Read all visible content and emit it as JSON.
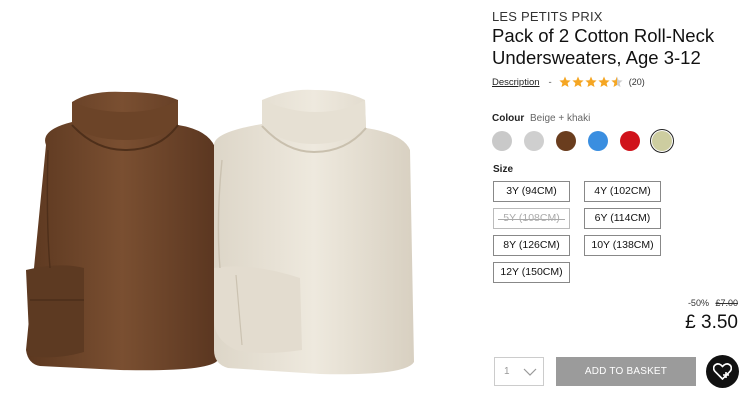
{
  "product": {
    "brand": "LES PETITS PRIX",
    "title": "Pack of 2 Cotton Roll-Neck Undersweaters, Age 3-12",
    "description_link": "Description",
    "separator": "-",
    "rating": 4.5,
    "review_count": "(20)"
  },
  "colour": {
    "label": "Colour",
    "selected": "Beige + khaki",
    "swatches": [
      {
        "name": "grey",
        "color": "#c9c9c9"
      },
      {
        "name": "light grey",
        "color": "#cfcfcf"
      },
      {
        "name": "brown",
        "color": "#6a3d1e"
      },
      {
        "name": "blue",
        "color": "#3a8ee0"
      },
      {
        "name": "red",
        "color": "#d0131b"
      },
      {
        "name": "beige + khaki",
        "color": "#cdcda0",
        "selected": true
      }
    ]
  },
  "size": {
    "label": "Size",
    "options": [
      {
        "label": "3Y (94CM)",
        "available": true
      },
      {
        "label": "4Y (102CM)",
        "available": true
      },
      {
        "label": "5Y (108CM)",
        "available": false
      },
      {
        "label": "6Y (114CM)",
        "available": true
      },
      {
        "label": "8Y (126CM)",
        "available": true
      },
      {
        "label": "10Y (138CM)",
        "available": true
      },
      {
        "label": "12Y (150CM)",
        "available": true
      }
    ]
  },
  "pricing": {
    "discount": "-50%",
    "old_price": "£7.00",
    "price": "£ 3.50"
  },
  "purchase": {
    "quantity": "1",
    "add_to_basket": "ADD TO BASKET"
  },
  "colors": {
    "brown_sweater": "#6b4329",
    "beige_sweater": "#e8e2d6",
    "star": "#f5a623",
    "button_grey": "#9b9b9b"
  }
}
